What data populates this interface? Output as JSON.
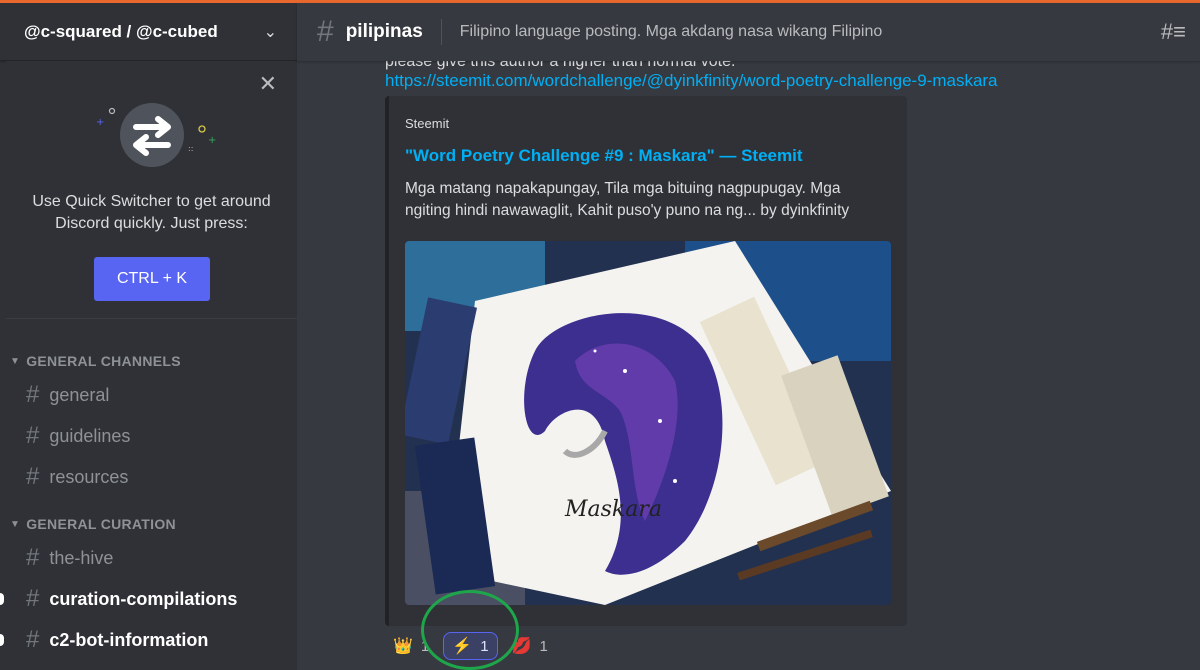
{
  "sidebar": {
    "guild_name": "@c-squared / @c-cubed",
    "quick_switcher": {
      "text": "Use Quick Switcher to get around Discord quickly. Just press:",
      "shortcut": "CTRL + K"
    },
    "categories": [
      {
        "name": "GENERAL CHANNELS",
        "channels": [
          {
            "name": "general"
          },
          {
            "name": "guidelines"
          },
          {
            "name": "resources"
          }
        ]
      },
      {
        "name": "GENERAL CURATION",
        "channels": [
          {
            "name": "the-hive"
          },
          {
            "name": "curation-compilations"
          },
          {
            "name": "c2-bot-information"
          }
        ]
      }
    ]
  },
  "header": {
    "channel_name": "pilipinas",
    "topic": "Filipino language posting. Mga akdang nasa wikang Filipino"
  },
  "message": {
    "cut_text": "please give this author a higher than normal vote.",
    "link": "https://steemit.com/wordchallenge/@dyinkfinity/word-poetry-challenge-9-maskara",
    "embed": {
      "provider": "Steemit",
      "title": "\"Word Poetry Challenge #9 : Maskara\" — Steemit",
      "description": "Mga matang napakapungay, Tila mga bituing nagpupugay. Mga ngiting hindi nawawaglit, Kahit puso'y puno na ng... by dyinkfinity",
      "image_caption": "Maskara"
    },
    "reactions": [
      {
        "emoji": "👑",
        "icon": "crown-emoji",
        "count": "1",
        "me": false
      },
      {
        "emoji": "⚡",
        "icon": "custom-emoji",
        "count": "1",
        "me": true
      },
      {
        "emoji": "💋",
        "icon": "lips-emoji",
        "count": "1",
        "me": false
      }
    ]
  },
  "colors": {
    "accent": "#5865f2",
    "link": "#00aff4",
    "top_border": "#e8682d",
    "highlight_circle": "#1fa64a"
  }
}
